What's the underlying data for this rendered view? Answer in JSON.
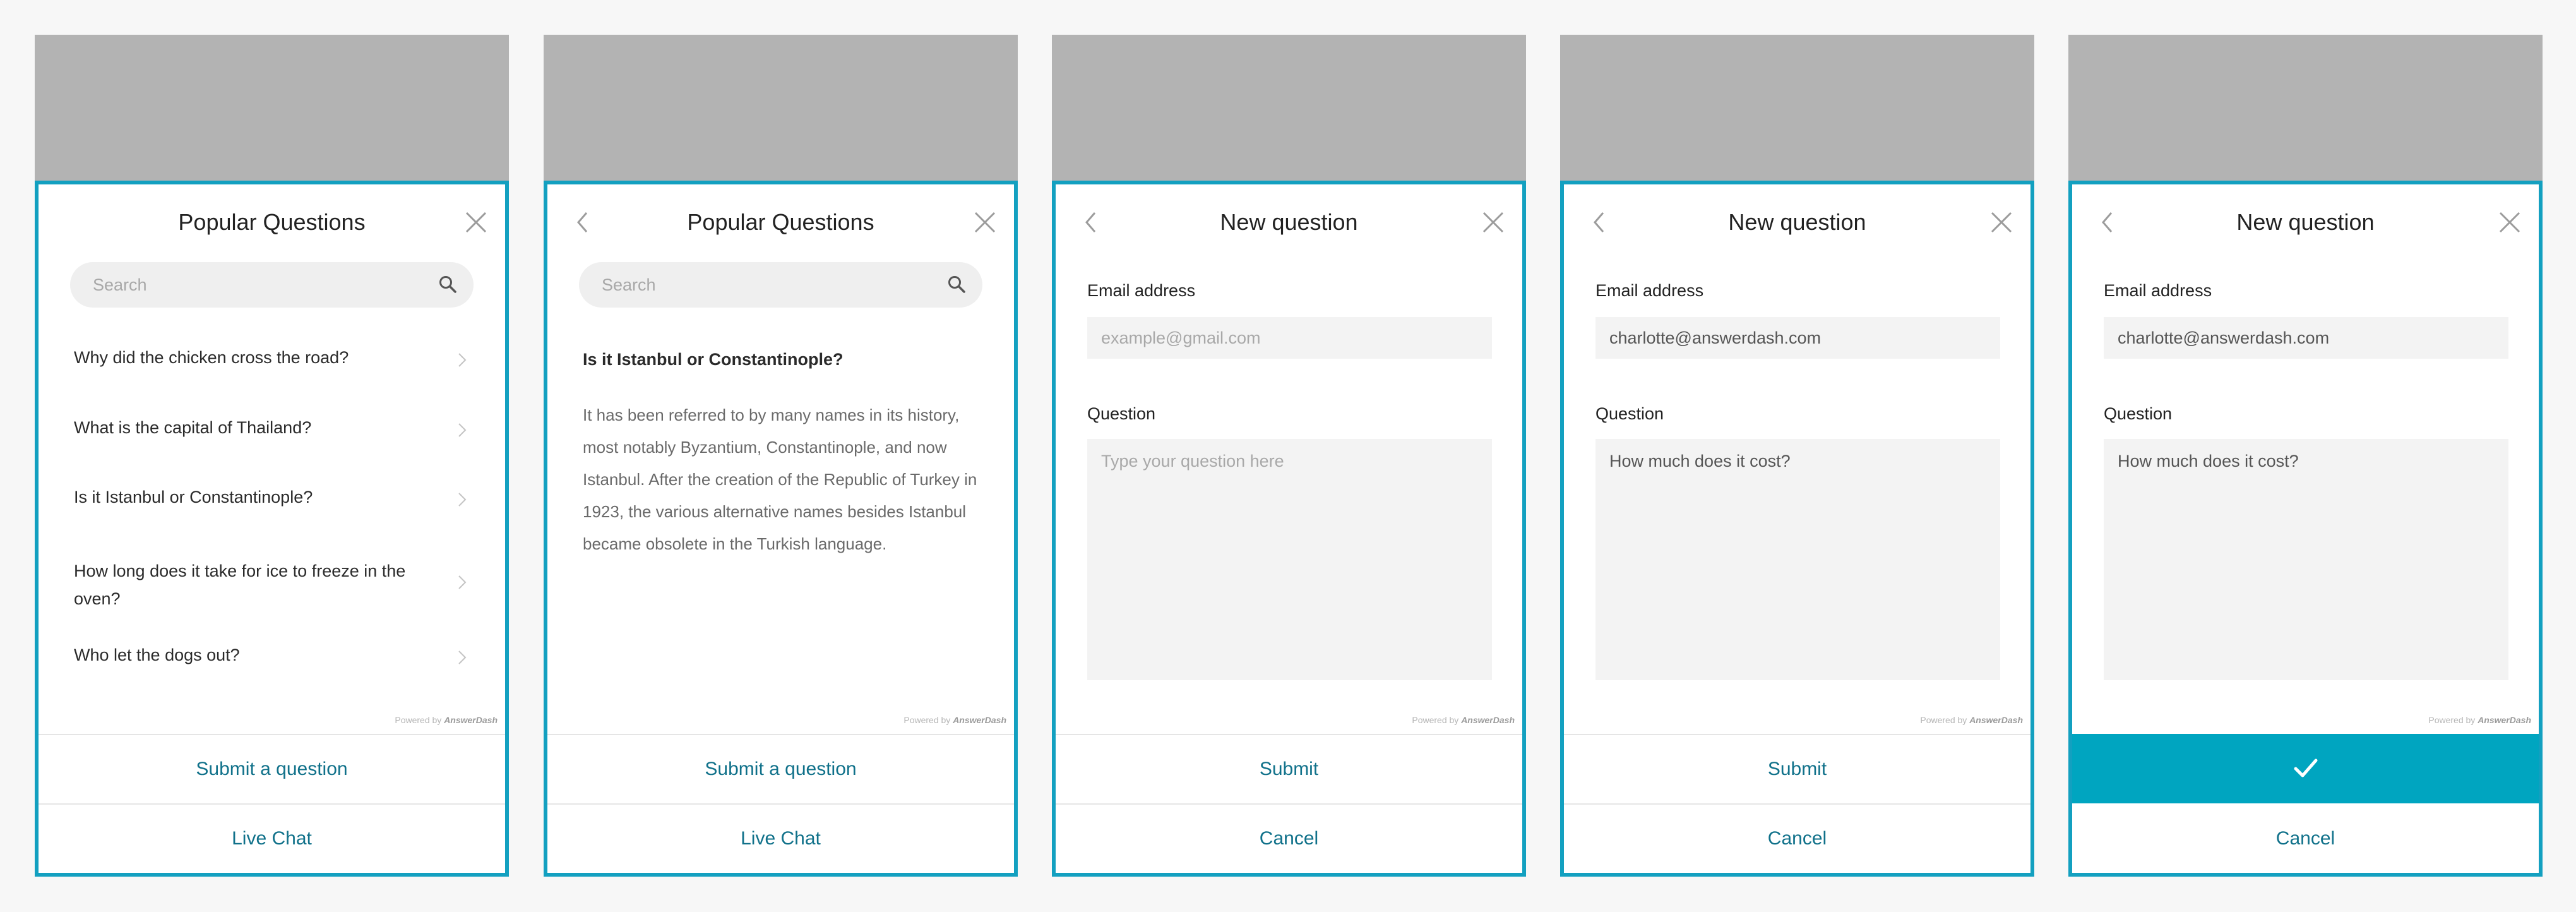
{
  "powered_by": {
    "prefix": "Powered by",
    "brand": "AnswerDash"
  },
  "panels": [
    {
      "title": "Popular Questions",
      "search_placeholder": "Search",
      "questions": [
        "Why did the chicken cross the road?",
        "What is the capital of Thailand?",
        "Is it Istanbul or Constantinople?",
        "How long does it take for ice to freeze in the oven?",
        "Who let the dogs out?"
      ],
      "primary_button": "Submit a question",
      "secondary_button": "Live Chat"
    },
    {
      "title": "Popular Questions",
      "search_placeholder": "Search",
      "article_title": "Is it Istanbul or Constantinople?",
      "article_body": "It has been referred to by many names in its history, most notably Byzantium, Constantinople, and now Istanbul. After the creation of the Republic of Turkey in 1923, the various alternative names besides Istanbul became obsolete in the Turkish language.",
      "primary_button": "Submit a question",
      "secondary_button": "Live Chat"
    },
    {
      "title": "New question",
      "email_label": "Email address",
      "email_value": "",
      "email_placeholder": "example@gmail.com",
      "question_label": "Question",
      "question_value": "",
      "question_placeholder": "Type your question here",
      "primary_button": "Submit",
      "secondary_button": "Cancel"
    },
    {
      "title": "New question",
      "email_label": "Email address",
      "email_value": "charlotte@answerdash.com",
      "question_label": "Question",
      "question_value": "How much does it cost?",
      "primary_button": "Submit",
      "secondary_button": "Cancel"
    },
    {
      "title": "New question",
      "email_label": "Email address",
      "email_value": "charlotte@answerdash.com",
      "question_label": "Question",
      "question_value": "How much does it cost?",
      "primary_button_icon": "checkmark-icon",
      "secondary_button": "Cancel"
    }
  ],
  "colors": {
    "accent": "#13a0c0",
    "button_text": "#10718a",
    "success_fill": "#00a5c0",
    "backdrop": "#b3b3b3"
  }
}
